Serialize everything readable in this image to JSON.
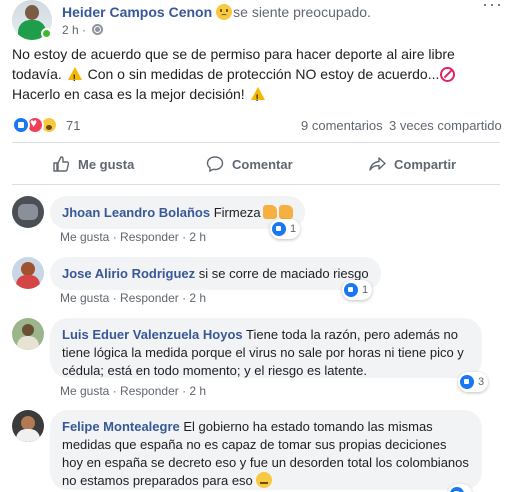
{
  "post": {
    "author": "Heider Campos Cenon",
    "feeling": "se siente preocupado.",
    "time": "2 h",
    "separator": "·",
    "text_1": "No estoy de acuerdo que se de permiso para hacer deporte al aire libre todavía.",
    "text_2": "Con o sin medidas de protección NO estoy de acuerdo...",
    "text_3": "Hacerlo en casa es la mejor decisión!",
    "reaction_count": "71",
    "comments_count": "9 comentarios",
    "shares_count": "3 veces compartido"
  },
  "actions": {
    "like": "Me gusta",
    "comment": "Comentar",
    "share": "Compartir"
  },
  "comments": [
    {
      "name": "Jhoan Leandro Bolaños",
      "text": "Firmeza",
      "like_label": "Me gusta",
      "reply_label": "Responder",
      "time": "2 h",
      "reactions": "1"
    },
    {
      "name": "Jose Alirio Rodriguez",
      "text": "si se corre de maciado riesgo",
      "like_label": "Me gusta",
      "reply_label": "Responder",
      "time": "2 h",
      "reactions": "1"
    },
    {
      "name": "Luis Eduer Valenzuela Hoyos",
      "text": "Tiene toda la razón, pero además no tiene lógica la medida porque el virus no sale por horas ni tiene pico y cédula; está en todo momento; y el riesgo es latente.",
      "like_label": "Me gusta",
      "reply_label": "Responder",
      "time": "2 h",
      "reactions": "3"
    },
    {
      "name": "Felipe Montealegre",
      "text": "El gobierno ha estado tomando las mismas medidas que españa no es capaz de tomar sus propias deciciones hoy en españa se decreto eso y fue un desorden total los colombianos no estamos preparados para eso",
      "reactions": ""
    }
  ],
  "icons": {
    "more": "more-options-icon",
    "globe": "globe-icon",
    "like": "thumbs-up-icon",
    "comment": "comment-icon",
    "share": "share-icon"
  },
  "colors": {
    "link": "#385898",
    "meta": "#606770",
    "bubble": "#f2f3f5",
    "like_blue": "#1877f2"
  }
}
